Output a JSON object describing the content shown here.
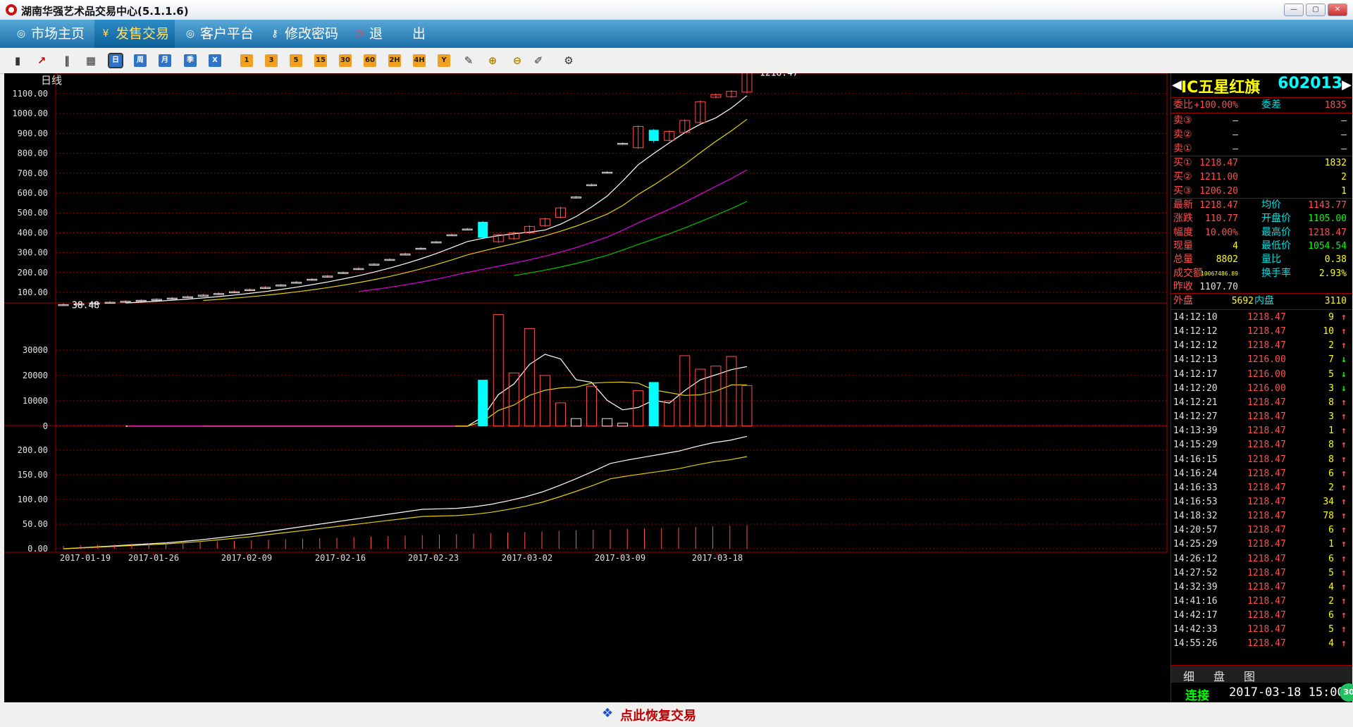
{
  "window": {
    "title": "湖南华强艺术品交易中心(5.1.1.6)",
    "controls": [
      "—",
      "▢",
      "✕"
    ]
  },
  "menu": [
    {
      "label": "市场主页",
      "icon": "globe-icon"
    },
    {
      "label": "发售交易",
      "icon": "yen-icon"
    },
    {
      "label": "客户平台",
      "icon": "globe-icon"
    },
    {
      "label": "修改密码",
      "icon": "key-icon"
    },
    {
      "label": "退",
      "icon": "power-icon"
    },
    {
      "label": "出",
      "icon": ""
    }
  ],
  "toolbar": {
    "period_buttons": [
      "日",
      "周",
      "月",
      "季",
      "X"
    ],
    "minute_buttons": [
      "1",
      "3",
      "5",
      "15",
      "30",
      "60",
      "2H",
      "4H",
      "Y"
    ]
  },
  "chart": {
    "period_label": "日线",
    "price_ticks": [
      "1100.00",
      "1000.00",
      "900.00",
      "800.00",
      "700.00",
      "600.00",
      "500.00",
      "400.00",
      "300.00",
      "200.00",
      "100.00"
    ],
    "low_label": "38.48",
    "high_label": "1218.47",
    "volume_ticks": [
      "30000",
      "20000",
      "10000",
      "0"
    ],
    "ind_ticks": [
      "200.00",
      "150.00",
      "100.00",
      "50.00",
      "0.00"
    ],
    "dates": [
      "2017-01-19",
      "2017-01-26",
      "2017-02-09",
      "2017-02-16",
      "2017-02-23",
      "2017-03-02",
      "2017-03-09",
      "2017-03-18"
    ]
  },
  "chart_data": {
    "type": "candlestick",
    "title": "日线",
    "price_range": [
      38.48,
      1218.47
    ],
    "candles": [
      {
        "o": 38.48,
        "c": 38.48
      },
      {
        "o": 41,
        "c": 42
      },
      {
        "o": 45,
        "c": 46
      },
      {
        "o": 49,
        "c": 50
      },
      {
        "o": 54,
        "c": 55
      },
      {
        "o": 59,
        "c": 60
      },
      {
        "o": 64,
        "c": 65
      },
      {
        "o": 70,
        "c": 71
      },
      {
        "o": 77,
        "c": 78
      },
      {
        "o": 85,
        "c": 86
      },
      {
        "o": 93,
        "c": 94
      },
      {
        "o": 102,
        "c": 103
      },
      {
        "o": 113,
        "c": 114
      },
      {
        "o": 124,
        "c": 125
      },
      {
        "o": 136,
        "c": 137
      },
      {
        "o": 150,
        "c": 151
      },
      {
        "o": 165,
        "c": 166
      },
      {
        "o": 181,
        "c": 182
      },
      {
        "o": 199,
        "c": 200
      },
      {
        "o": 219,
        "c": 220
      },
      {
        "o": 241,
        "c": 242
      },
      {
        "o": 265,
        "c": 266
      },
      {
        "o": 292,
        "c": 293
      },
      {
        "o": 321,
        "c": 322
      },
      {
        "o": 353,
        "c": 354
      },
      {
        "o": 389,
        "c": 390
      },
      {
        "o": 418,
        "c": 419
      },
      {
        "o": 455,
        "c": 375
      },
      {
        "o": 355,
        "c": 390
      },
      {
        "o": 370,
        "c": 400
      },
      {
        "o": 400,
        "c": 432
      },
      {
        "o": 436,
        "c": 470
      },
      {
        "o": 478,
        "c": 525
      },
      {
        "o": 578,
        "c": 580
      },
      {
        "o": 640,
        "c": 642
      },
      {
        "o": 703,
        "c": 705
      },
      {
        "o": 848,
        "c": 850
      },
      {
        "o": 828,
        "c": 935
      },
      {
        "o": 918,
        "c": 862
      },
      {
        "o": 865,
        "c": 910
      },
      {
        "o": 905,
        "c": 965
      },
      {
        "o": 955,
        "c": 1060
      },
      {
        "o": 1082,
        "c": 1095
      },
      {
        "o": 1085,
        "c": 1112
      },
      {
        "o": 1107.7,
        "c": 1218.47
      }
    ],
    "volume": [
      0,
      0,
      0,
      0,
      0,
      0,
      0,
      0,
      0,
      0,
      0,
      0,
      0,
      0,
      0,
      0,
      0,
      0,
      0,
      0,
      0,
      0,
      0,
      0,
      0,
      0,
      0,
      18300,
      44000,
      21000,
      38500,
      20000,
      9200,
      3000,
      15800,
      3000,
      1200,
      14000,
      17400,
      10000,
      27800,
      22500,
      23700,
      27500,
      16000,
      8800
    ],
    "indicator": [
      0,
      2,
      4,
      6,
      8,
      10,
      12,
      15,
      18,
      22,
      26,
      30,
      35,
      40,
      45,
      50,
      55,
      60,
      65,
      70,
      75,
      80,
      81,
      82,
      85,
      90,
      97,
      105,
      115,
      128,
      142,
      157,
      173,
      180,
      186,
      192,
      198,
      207,
      215,
      220,
      228
    ]
  },
  "side": {
    "name": "IC五星红旗",
    "code": "602013",
    "webi_label": "委比",
    "webi": "+100.00%",
    "weicha_label": "委差",
    "weicha": "1835",
    "sells": [
      {
        "label": "卖③",
        "price": "—",
        "vol": "—"
      },
      {
        "label": "卖②",
        "price": "—",
        "vol": "—"
      },
      {
        "label": "卖①",
        "price": "—",
        "vol": "—"
      }
    ],
    "buys": [
      {
        "label": "买①",
        "price": "1218.47",
        "vol": "1832"
      },
      {
        "label": "买②",
        "price": "1211.00",
        "vol": "2"
      },
      {
        "label": "买③",
        "price": "1206.20",
        "vol": "1"
      }
    ],
    "stats": [
      {
        "l1": "最新",
        "v1": "1218.47",
        "l2": "均价",
        "v2": "1143.77",
        "c1": "#ff5050",
        "c2": "#ff5050"
      },
      {
        "l1": "涨跌",
        "v1": "110.77",
        "l2": "开盘价",
        "v2": "1105.00",
        "c1": "#ff5050",
        "c2": "#00ff00"
      },
      {
        "l1": "幅度",
        "v1": "10.00%",
        "l2": "最高价",
        "v2": "1218.47",
        "c1": "#ff5050",
        "c2": "#ff5050"
      },
      {
        "l1": "现量",
        "v1": "4",
        "l2": "最低价",
        "v2": "1054.54",
        "c1": "#ffff00",
        "c2": "#00ff00"
      },
      {
        "l1": "总量",
        "v1": "8802",
        "l2": "量比",
        "v2": "0.38",
        "c1": "#ffff00",
        "c2": "#ffff00"
      },
      {
        "l1": "成交额",
        "v1": "10067486.89",
        "l2": "换手率",
        "v2": "2.93%",
        "c1": "#ffff00",
        "c2": "#ffff00"
      },
      {
        "l1": "昨收",
        "v1": "1107.70",
        "l2": "",
        "v2": "",
        "c1": "#e0e0e0",
        "c2": "#e0e0e0"
      }
    ],
    "waipan_label": "外盘",
    "waipan": "5692",
    "neipan_label": "内盘",
    "neipan": "3110",
    "ticks": [
      {
        "t": "14:12:10",
        "p": "1218.47",
        "v": "9",
        "d": "↑"
      },
      {
        "t": "14:12:12",
        "p": "1218.47",
        "v": "10",
        "d": "↑"
      },
      {
        "t": "14:12:12",
        "p": "1218.47",
        "v": "2",
        "d": "↑"
      },
      {
        "t": "14:12:13",
        "p": "1216.00",
        "v": "7",
        "d": "↓"
      },
      {
        "t": "14:12:17",
        "p": "1216.00",
        "v": "5",
        "d": "↓"
      },
      {
        "t": "14:12:20",
        "p": "1216.00",
        "v": "3",
        "d": "↓"
      },
      {
        "t": "14:12:21",
        "p": "1218.47",
        "v": "8",
        "d": "↑"
      },
      {
        "t": "14:12:27",
        "p": "1218.47",
        "v": "3",
        "d": "↑"
      },
      {
        "t": "14:13:39",
        "p": "1218.47",
        "v": "1",
        "d": "↑"
      },
      {
        "t": "14:15:29",
        "p": "1218.47",
        "v": "8",
        "d": "↑"
      },
      {
        "t": "14:16:15",
        "p": "1218.47",
        "v": "8",
        "d": "↑"
      },
      {
        "t": "14:16:24",
        "p": "1218.47",
        "v": "6",
        "d": "↑"
      },
      {
        "t": "14:16:33",
        "p": "1218.47",
        "v": "2",
        "d": "↑"
      },
      {
        "t": "14:16:53",
        "p": "1218.47",
        "v": "34",
        "d": "↑"
      },
      {
        "t": "14:18:32",
        "p": "1218.47",
        "v": "78",
        "d": "↑"
      },
      {
        "t": "14:20:57",
        "p": "1218.47",
        "v": "6",
        "d": "↑"
      },
      {
        "t": "14:25:29",
        "p": "1218.47",
        "v": "1",
        "d": "↑"
      },
      {
        "t": "14:26:12",
        "p": "1218.47",
        "v": "6",
        "d": "↑"
      },
      {
        "t": "14:27:52",
        "p": "1218.47",
        "v": "5",
        "d": "↑"
      },
      {
        "t": "14:32:39",
        "p": "1218.47",
        "v": "4",
        "d": "↑"
      },
      {
        "t": "14:41:16",
        "p": "1218.47",
        "v": "2",
        "d": "↑"
      },
      {
        "t": "14:42:17",
        "p": "1218.47",
        "v": "6",
        "d": "↑"
      },
      {
        "t": "14:42:33",
        "p": "1218.47",
        "v": "5",
        "d": "↑"
      },
      {
        "t": "14:55:26",
        "p": "1218.47",
        "v": "4",
        "d": "↑"
      }
    ],
    "tabs": [
      "细",
      "盘",
      "图"
    ],
    "connection": "连接",
    "datetime": "2017-03-18 15:00",
    "badge": "30"
  },
  "bottom": {
    "restore_label": "点此恢复交易"
  }
}
